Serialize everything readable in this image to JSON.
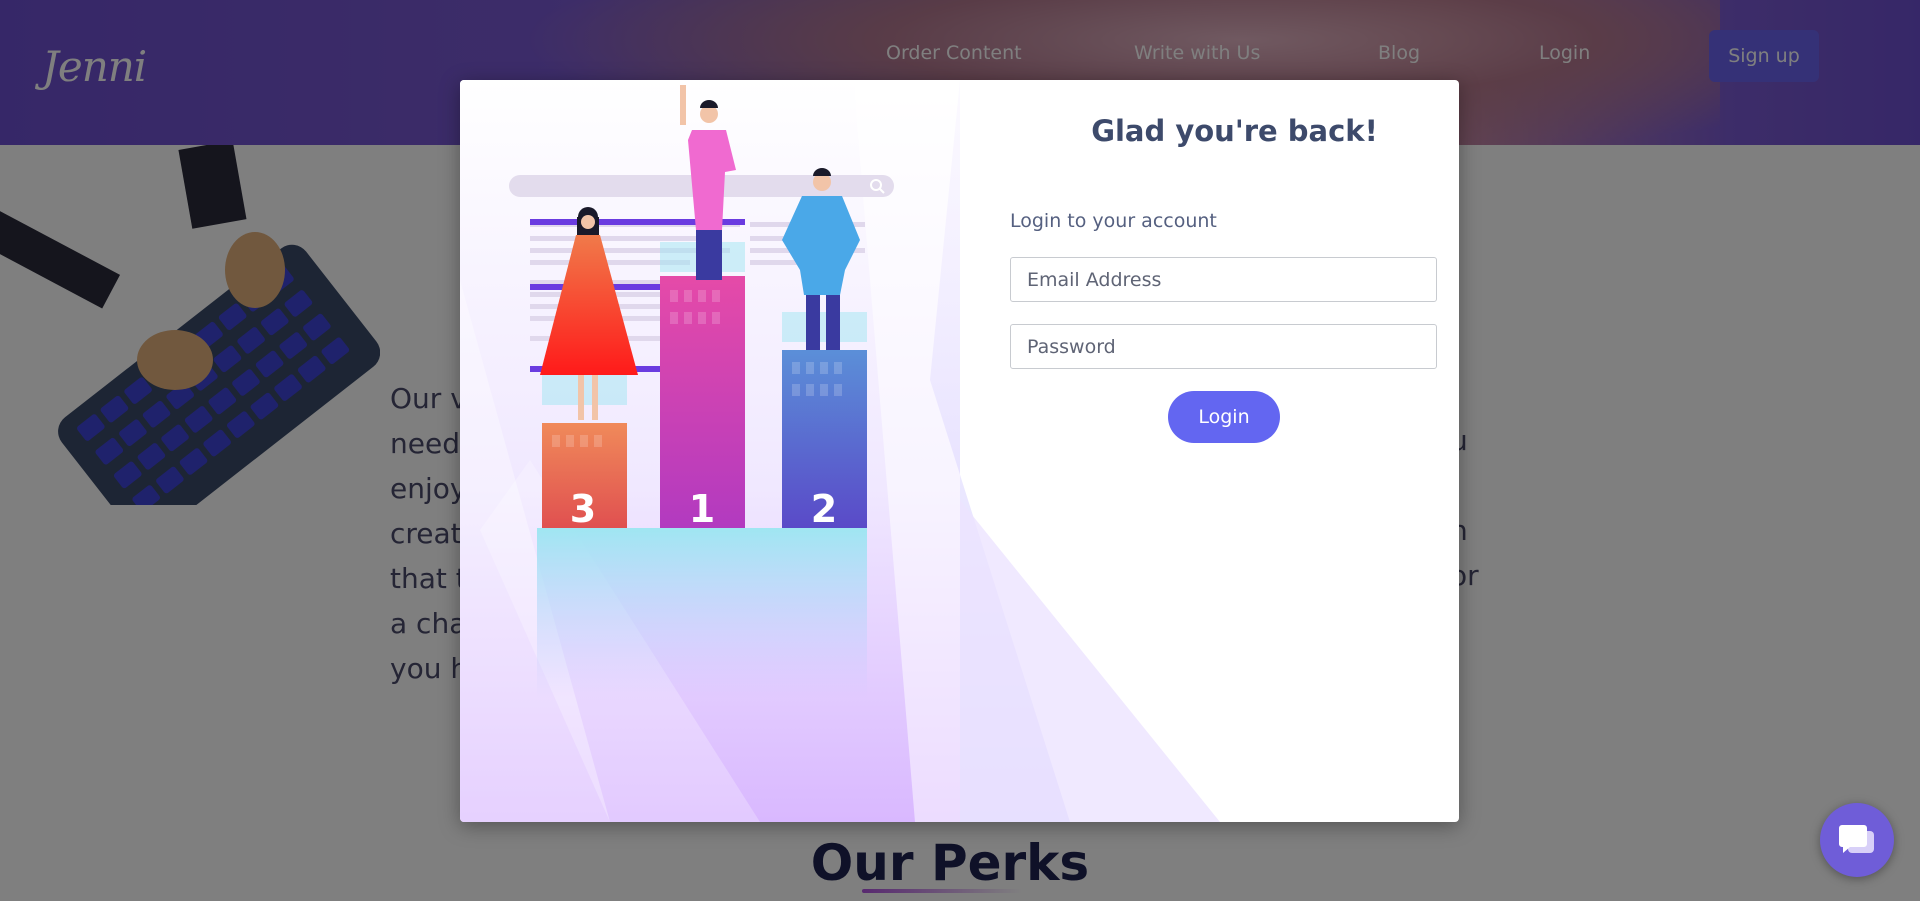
{
  "brand": {
    "logo_text": "Jenni"
  },
  "nav": {
    "items": [
      {
        "label": "Order Content"
      },
      {
        "label": "Write with Us"
      },
      {
        "label": "Blog"
      },
      {
        "label": "Login"
      }
    ],
    "signup_label": "Sign up"
  },
  "background": {
    "lines": [
      "Our v",
      "needs",
      "enjoy",
      "create",
      "that t",
      "a cha",
      "you h"
    ],
    "right_fragments": [
      "u",
      "h",
      "or"
    ],
    "perks_title": "Our Perks"
  },
  "modal": {
    "title": "Glad you're back!",
    "subtitle": "Login to your account",
    "email_placeholder": "Email Address",
    "password_placeholder": "Password",
    "login_label": "Login",
    "podium_numbers": [
      "3",
      "1",
      "2"
    ]
  },
  "colors": {
    "accent": "#6366f1",
    "nav_bg": "#6d4fd0",
    "title": "#3d4a6b",
    "perks": "#1f2350"
  },
  "icons": {
    "chat": "chat-bubble-icon",
    "search": "search-icon"
  }
}
